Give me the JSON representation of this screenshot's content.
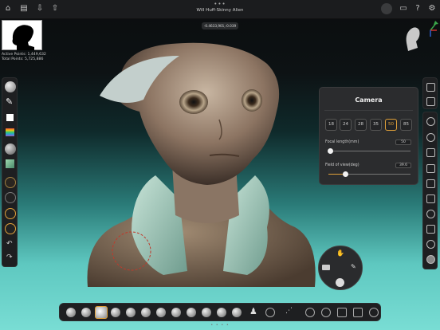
{
  "topbar": {
    "title": "Will Huff-Skinny Alien",
    "dots": "•••",
    "icons": [
      "home-icon",
      "save-icon",
      "import-icon",
      "share-icon",
      "avatar-icon",
      "vr-icon",
      "help-icon",
      "settings-icon"
    ]
  },
  "stats": {
    "active_points": "Active Points: 1,449,632",
    "total_points": "Total Points: 5,725,886"
  },
  "coords": "-0.4633,901,-0.039",
  "camera": {
    "title": "Camera",
    "focal_presets": [
      "18",
      "24",
      "28",
      "35",
      "50",
      "85"
    ],
    "active_preset": "50",
    "focal_length_label": "Focal length(mm)",
    "focal_length_value": "50",
    "focal_length_level": 0.02,
    "fov_label": "Field of view(deg)",
    "fov_value": "39.6",
    "fov_level": 0.2
  },
  "colors": {
    "accent": "#e0a13a",
    "panel": "#2b2c2e",
    "toolbar": "#1e1f21"
  },
  "bottom_dots": "• • • •"
}
